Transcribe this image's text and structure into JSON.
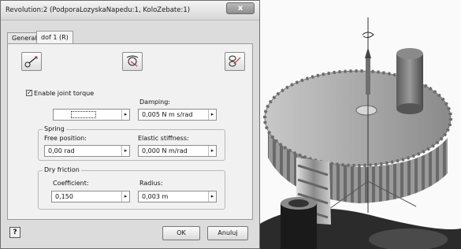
{
  "dialog": {
    "title": "Revolution:2 (PodporaLozyskaNapedu:1, KoloZebate:1)",
    "close_label": "x",
    "tabs": [
      {
        "label": "General",
        "selected": false
      },
      {
        "label": "dof 1 (R)",
        "selected": true
      }
    ],
    "tool_icons": [
      "spring-damper-icon",
      "rotation-joint-icon",
      "friction-icon"
    ],
    "enable_torque": {
      "label": "Enable joint torque",
      "checked": true
    },
    "motion_combo": {
      "value": "",
      "arrow": "▸"
    },
    "damping": {
      "label": "Damping:",
      "value": "0,005 N m s/rad"
    },
    "spring": {
      "title": "Spring",
      "free_position": {
        "label": "Free position:",
        "value": "0,00 rad"
      },
      "elastic_stiffness": {
        "label": "Elastic stiffness:",
        "value": "0,000 N m/rad"
      }
    },
    "dry_friction": {
      "title": "Dry friction",
      "coefficient": {
        "label": "Coefficient:",
        "value": "0,150"
      },
      "radius": {
        "label": "Radius:",
        "value": "0,003 m"
      }
    },
    "help_label": "?",
    "ok_label": "OK",
    "cancel_label": "Anuluj"
  },
  "viewport": {
    "gear_color": "#9c9c9c",
    "pin_color": "#6f6f6f"
  }
}
